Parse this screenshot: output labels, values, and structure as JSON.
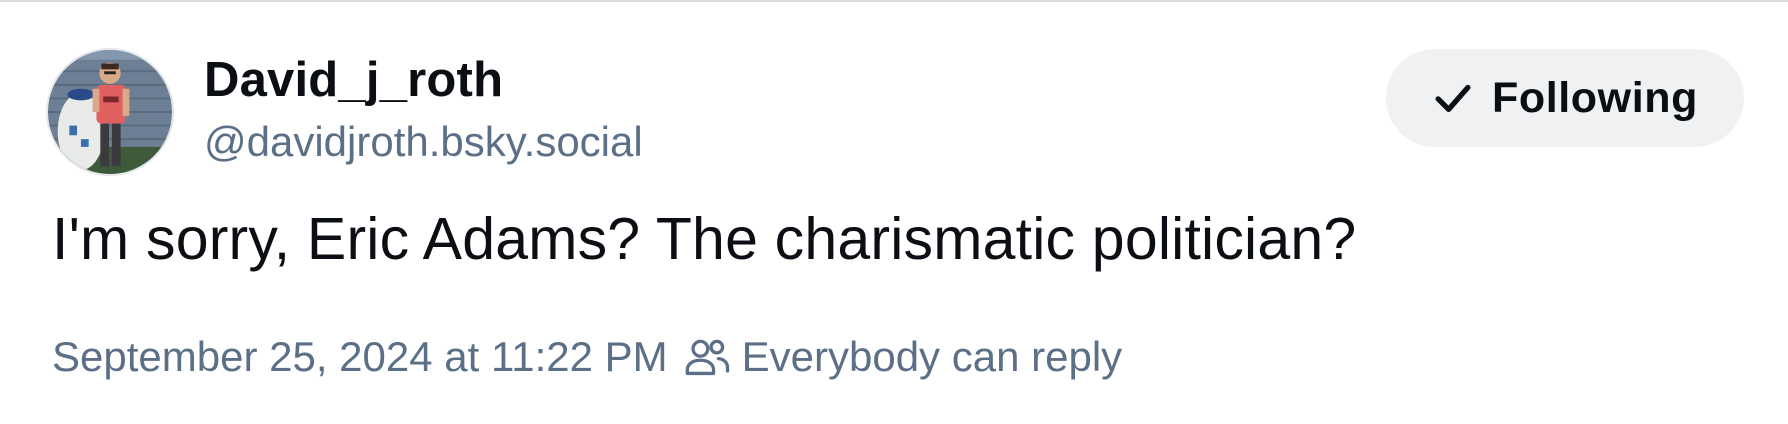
{
  "post": {
    "author": {
      "display_name": "David_j_roth",
      "handle": "@davidjroth.bsky.social",
      "avatar_icon": "avatar-photo"
    },
    "follow_button": {
      "label": "Following",
      "icon": "checkmark-icon"
    },
    "text": "I'm sorry, Eric Adams? The charismatic politician?",
    "timestamp": "September 25, 2024 at 11:22 PM",
    "reply_setting": {
      "icon": "people-icon",
      "label": "Everybody can reply"
    }
  },
  "colors": {
    "text_primary": "#0b0f14",
    "text_secondary": "#5b7087",
    "button_background": "#eff1f3"
  }
}
